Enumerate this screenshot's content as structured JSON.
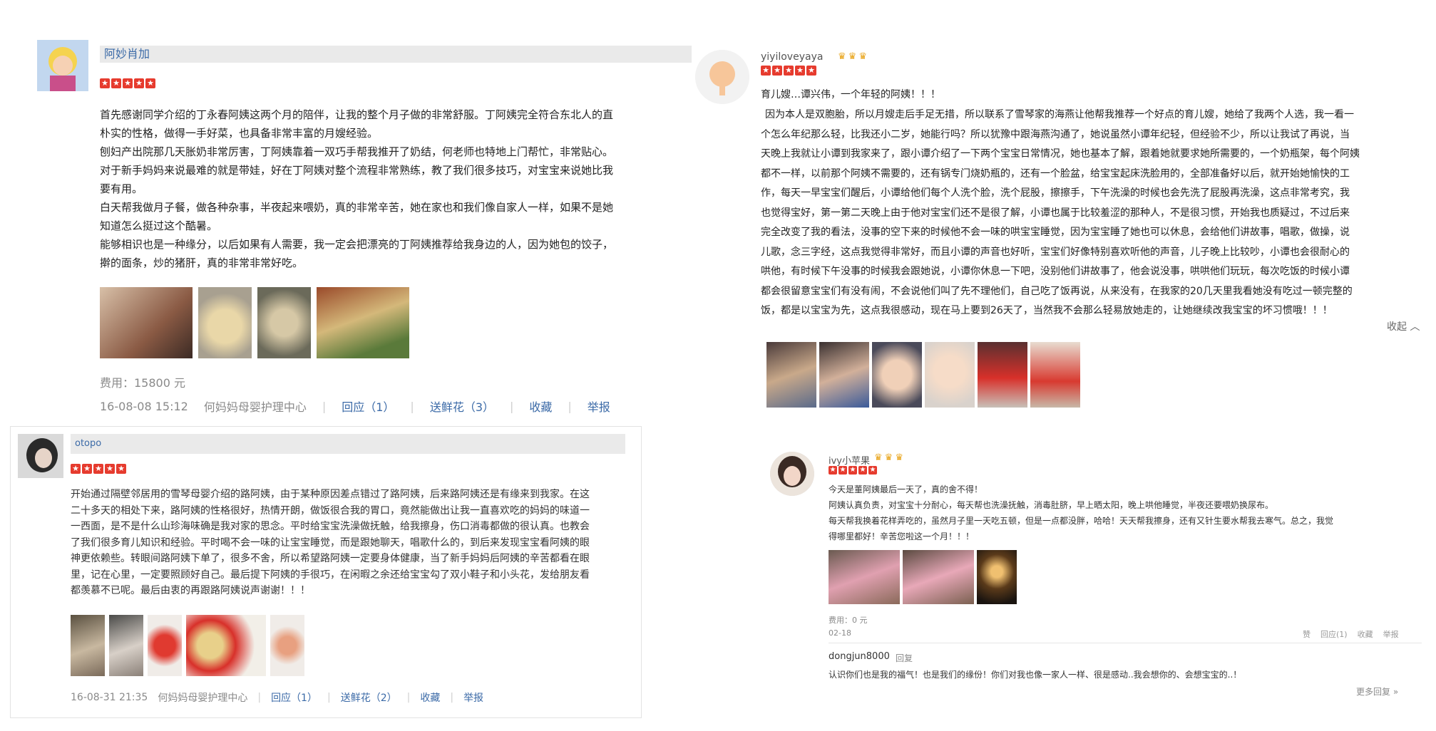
{
  "r1": {
    "username": "阿妙肖加",
    "stars": [
      "★",
      "★",
      "★",
      "★",
      "★"
    ],
    "lines": [
      "首先感谢同学介绍的丁永春阿姨这两个月的陪伴，让我的整个月子做的非常舒服。丁阿姨完全符合东北人的直",
      "朴实的性格，做得一手好菜，也具备非常丰富的月嫂经验。",
      "刨妇产出院那几天胀奶非常厉害，丁阿姨靠着一双巧手帮我推开了奶结，何老师也特地上门帮忙，非常贴心。",
      "对于新手妈妈来说最难的就是带娃，好在丁阿姨对整个流程非常熟练，教了我们很多技巧，对宝宝来说她比我",
      "要有用。",
      "白天帮我做月子餐，做各种杂事，半夜起来喂奶，真的非常辛苦，她在家也和我们像自家人一样，如果不是她",
      "知道怎么挺过这个酷暑。",
      "能够相识也是一种缘分，以后如果有人需要，我一定会把漂亮的丁阿姨推荐给我身边的人，因为她包的饺子，",
      "擀的面条，炒的猪肝，真的非常非常好吃。"
    ],
    "cost": "费用：15800 元",
    "date": "16-08-08 15:12",
    "center": "何妈妈母婴护理中心",
    "reply": "回应（1）",
    "flowers": "送鲜花（3）",
    "collect": "收藏",
    "report": "举报"
  },
  "r2": {
    "username": "yiyiloveyaya",
    "crowns": [
      "♛",
      "♛",
      "♛"
    ],
    "stars": [
      "★",
      "★",
      "★",
      "★",
      "★"
    ],
    "headline": "育儿嫂…谭兴伟，一个年轻的阿姨！！！",
    "lines": [
      "因为本人是双胞胎，所以月嫂走后手足无措，所以联系了雪琴家的海燕让他帮我推荐一个好点的育儿嫂，她给了我两个人选，我一看一",
      "个怎么年纪那么轻，比我还小二岁，她能行吗？所以犹豫中跟海燕沟通了，她说虽然小谭年纪轻，但经验不少，所以让我试了再说，当",
      "天晚上我就让小谭到我家来了，跟小谭介绍了一下两个宝宝日常情况，她也基本了解，跟着她就要求她所需要的，一个奶瓶架，每个阿姨",
      "都不一样，以前那个阿姨不需要的，还有锅专门烧奶瓶的，还有一个脸盆，给宝宝起床洗脸用的，全部准备好以后，就开始她愉快的工",
      "作，每天一早宝宝们醒后，小谭给他们每个人洗个脸，洗个屁股，擦擦手，下午洗澡的时候也会先洗了屁股再洗澡，这点非常考究，我",
      "也觉得宝好，第一第二天晚上由于他对宝宝们还不是很了解，小谭也属于比较羞涩的那种人，不是很习惯，开始我也质疑过，不过后来",
      "完全改变了我的看法，没事的空下来的时候他不会一味的哄宝宝睡觉，因为宝宝睡了她也可以休息，会给他们讲故事，唱歌，做操，说",
      "儿歌，念三字经，这点我觉得非常好，而且小谭的声音也好听，宝宝们好像特别喜欢听他的声音，儿子晚上比较吵，小谭也会很耐心的",
      "哄他，有时候下午没事的时候我会跟她说，小谭你休息一下吧，没别他们讲故事了，他会说没事，哄哄他们玩玩，每次吃饭的时候小谭",
      "都会很留意宝宝们有没有闹，不会说他们叫了先不理他们，自己吃了饭再说，从来没有，在我家的20几天里我看她没有吃过一顿完整的",
      "饭，都是以宝宝为先，这点我很感动，现在马上要到26天了，当然我不会那么轻易放她走的，让她继续改我宝宝的坏习惯哦！！！"
    ],
    "collapse": "收起 ︿"
  },
  "r3": {
    "username": "otopo",
    "stars": [
      "★",
      "★",
      "★",
      "★",
      "★"
    ],
    "lines": [
      "开始通过隔壁邻居用的雪琴母婴介绍的路阿姨，由于某种原因差点错过了路阿姨，后来路阿姨还是有缘来到我家。在这",
      "二十多天的相处下来，路阿姨的性格很好，热情开朗，做饭很合我的胃口，竟然能做出让我一直喜欢吃的妈妈的味道一",
      "一西面，是不是什么山珍海味确是我对家的思念。平时给宝宝洗澡做抚触，给我擦身，伤口消毒都做的很认真。也教会",
      "了我们很多育儿知识和经验。平时喝不会一味的让宝宝睡觉，而是跟她聊天，唱歌什么的，到后来发现宝宝看阿姨的眼",
      "神更依赖些。转眼间路阿姨下单了，很多不舍，所以希望路阿姨一定要身体健康，当了新手妈妈后阿姨的辛苦都看在眼",
      "里，记在心里，一定要照顾好自己。最后提下阿姨的手很巧，在闲暇之余还给宝宝勾了双小鞋子和小头花，发给朋友看",
      "都羡慕不已呢。最后由衷的再跟路阿姨说声谢谢！！！"
    ],
    "date": "16-08-31 21:35",
    "center": "何妈妈母婴护理中心",
    "reply": "回应（1）",
    "flowers": "送鲜花（2）",
    "collect": "收藏",
    "report": "举报"
  },
  "r4": {
    "username": "ivy小苹果",
    "crowns": [
      "♛",
      "♛",
      "♛"
    ],
    "stars": [
      "★",
      "★",
      "★",
      "★",
      "★"
    ],
    "lines": [
      "今天是董阿姨最后一天了，真的舍不得！",
      "阿姨认真负责，对宝宝十分耐心，每天帮也洗澡抚触，消毒肚脐，早上晒太阳，晚上哄他睡觉，半夜还要喂奶换尿布。",
      "每天帮我换着花样弄吃的，虽然月子里一天吃五顿，但是一点都没胖，哈哈！天天帮我擦身，还有又针生要水帮我去寒气。总之，我觉",
      "得哪里都好！辛苦您啦这一个月！！！"
    ],
    "cost": "费用：0 元",
    "date": "02-18",
    "actions": [
      "赞",
      "回应(1)",
      "收藏",
      "举报"
    ],
    "reply_user": "dongjun8000",
    "reply_tag": "回复",
    "reply_text": "认识你们也是我的福气！也是我们的缘份！你们对我也像一家人一样、很是感动..我会想你的、会想宝宝的..！",
    "more": "更多回复 »"
  },
  "colors": {
    "link": "#3b6aa7",
    "star": "#e63b2e",
    "crown": "#e8a317",
    "muted": "#8a8a8a"
  }
}
